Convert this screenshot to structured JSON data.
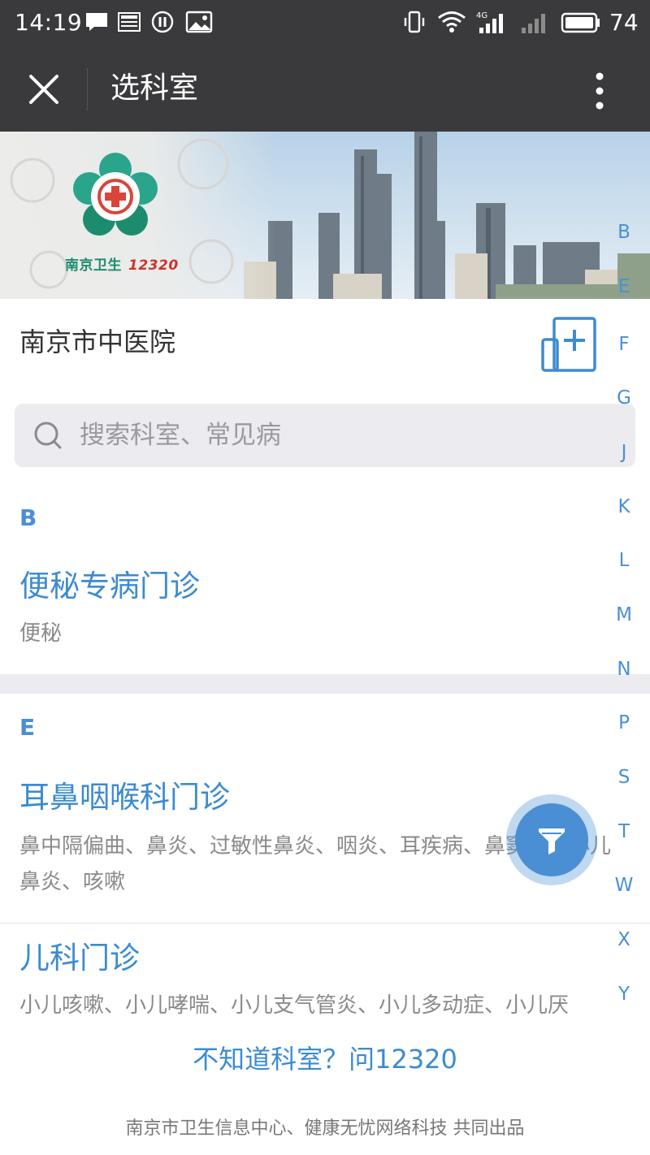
{
  "status_bar": {
    "time": "14:19",
    "battery_level": "74",
    "network": "4G",
    "icons": [
      "message-icon",
      "news-icon",
      "pause-icon",
      "image-icon",
      "vibrate-icon",
      "wifi-icon",
      "signal-icon",
      "signal-empty-icon",
      "battery-icon"
    ]
  },
  "title_bar": {
    "title": "选科室",
    "close_icon": "close-icon",
    "more_icon": "more-vertical-icon"
  },
  "banner": {
    "logo_text": "南京卫生",
    "logo_number": "12320"
  },
  "hospital": {
    "name": "南京市中医院",
    "icon": "hospital-icon"
  },
  "search": {
    "placeholder": "搜索科室、常见病",
    "value": ""
  },
  "sections": [
    {
      "letter": "B",
      "departments": [
        {
          "name": "便秘专病门诊",
          "desc": "便秘"
        }
      ]
    },
    {
      "letter": "E",
      "departments": [
        {
          "name": "耳鼻咽喉科门诊",
          "desc": "鼻中隔偏曲、鼻炎、过敏性鼻炎、咽炎、耳疾病、鼻窦炎、小儿鼻炎、咳嗽"
        },
        {
          "name": "儿科门诊",
          "desc": "小儿咳嗽、小儿哮喘、小儿支气管炎、小儿多动症、小儿厌"
        }
      ]
    }
  ],
  "index_letters": [
    "B",
    "E",
    "F",
    "G",
    "J",
    "K",
    "L",
    "M",
    "N",
    "P",
    "S",
    "T",
    "W",
    "X",
    "Y"
  ],
  "filter_button": {
    "icon": "filter-icon"
  },
  "footer": {
    "ask_link": "不知道科室？问12320",
    "credit": "南京市卫生信息中心、健康无忧网络科技 共同出品"
  },
  "colors": {
    "bar_bg": "#3a3a3c",
    "accent": "#4a8fd4",
    "link": "#3c8bd0",
    "muted": "#8a8a8a",
    "search_bg": "#ececf0"
  }
}
